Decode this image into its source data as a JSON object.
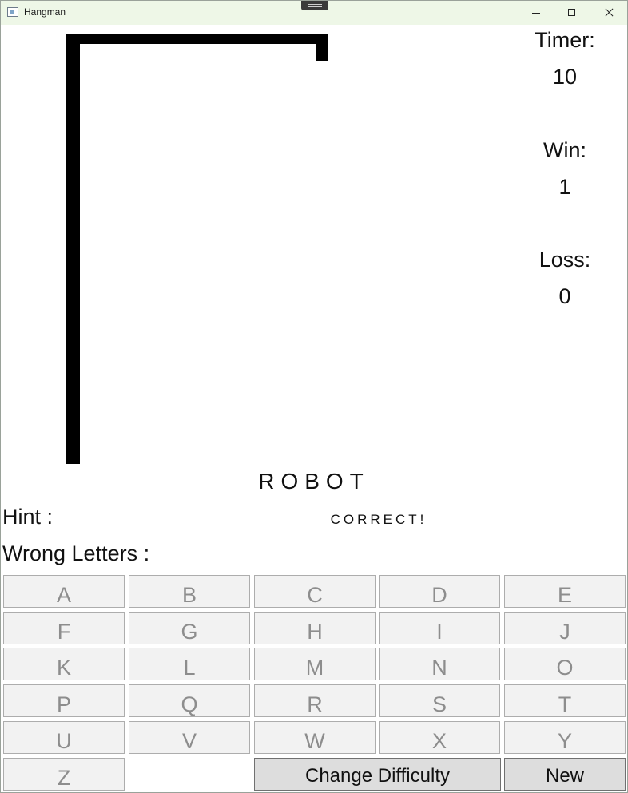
{
  "window": {
    "title": "Hangman"
  },
  "stats": {
    "timer_label": "Timer:",
    "timer_value": "10",
    "win_label": "Win:",
    "win_value": "1",
    "loss_label": "Loss:",
    "loss_value": "0"
  },
  "game": {
    "word": "ROBOT",
    "hint_label": "Hint :",
    "status": "CORRECT!",
    "wrong_letters_label": "Wrong Letters :"
  },
  "keyboard": {
    "letters": [
      "A",
      "B",
      "C",
      "D",
      "E",
      "F",
      "G",
      "H",
      "I",
      "J",
      "K",
      "L",
      "M",
      "N",
      "O",
      "P",
      "Q",
      "R",
      "S",
      "T",
      "U",
      "V",
      "W",
      "X",
      "Y",
      "Z"
    ]
  },
  "actions": {
    "change_difficulty": "Change Difficulty",
    "new": "New"
  },
  "colors": {
    "titlebar": "#eef7e7",
    "key_background": "#f2f2f2",
    "key_text_disabled": "#8d8d8d",
    "action_button": "#dddddd"
  }
}
